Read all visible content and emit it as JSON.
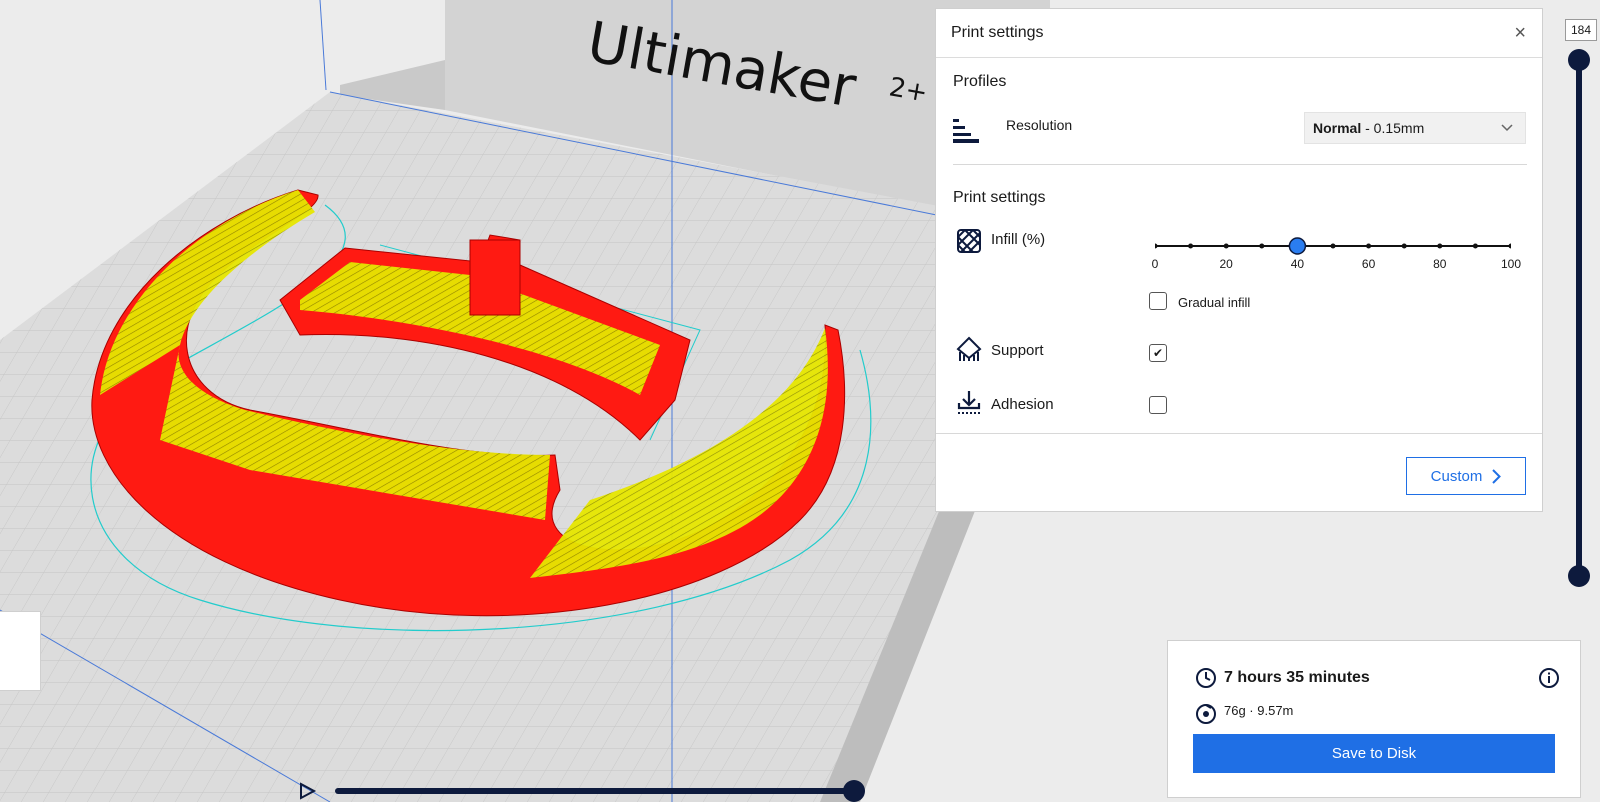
{
  "viewport": {
    "brand_text": "Ultimaker",
    "brand_suffix": "2+",
    "colors": {
      "model_wall": "#ff1a12",
      "model_infill": "#e6e600",
      "skirt": "#22cccc",
      "bed": "#dedede"
    }
  },
  "print_settings_panel": {
    "title": "Print settings",
    "close_icon": "×",
    "profiles_label": "Profiles",
    "resolution": {
      "label": "Resolution",
      "value_bold": "Normal",
      "value_rest": " - 0.15mm"
    },
    "section_label": "Print settings",
    "infill": {
      "label": "Infill (%)",
      "value": 40,
      "ticks": [
        "0",
        "20",
        "40",
        "60",
        "80",
        "100"
      ]
    },
    "gradual_infill": {
      "label": "Gradual infill",
      "checked": false
    },
    "support": {
      "label": "Support",
      "checked": true,
      "check_mark": "✔"
    },
    "adhesion": {
      "label": "Adhesion",
      "checked": false
    },
    "custom_button": "Custom"
  },
  "layer_slider": {
    "value": "184"
  },
  "estimate": {
    "time": "7 hours 35 minutes",
    "material": "76g · 9.57m",
    "save_button": "Save to Disk"
  },
  "accent_color": "#1f6fe5",
  "slider_dark": "#0d1a3d"
}
